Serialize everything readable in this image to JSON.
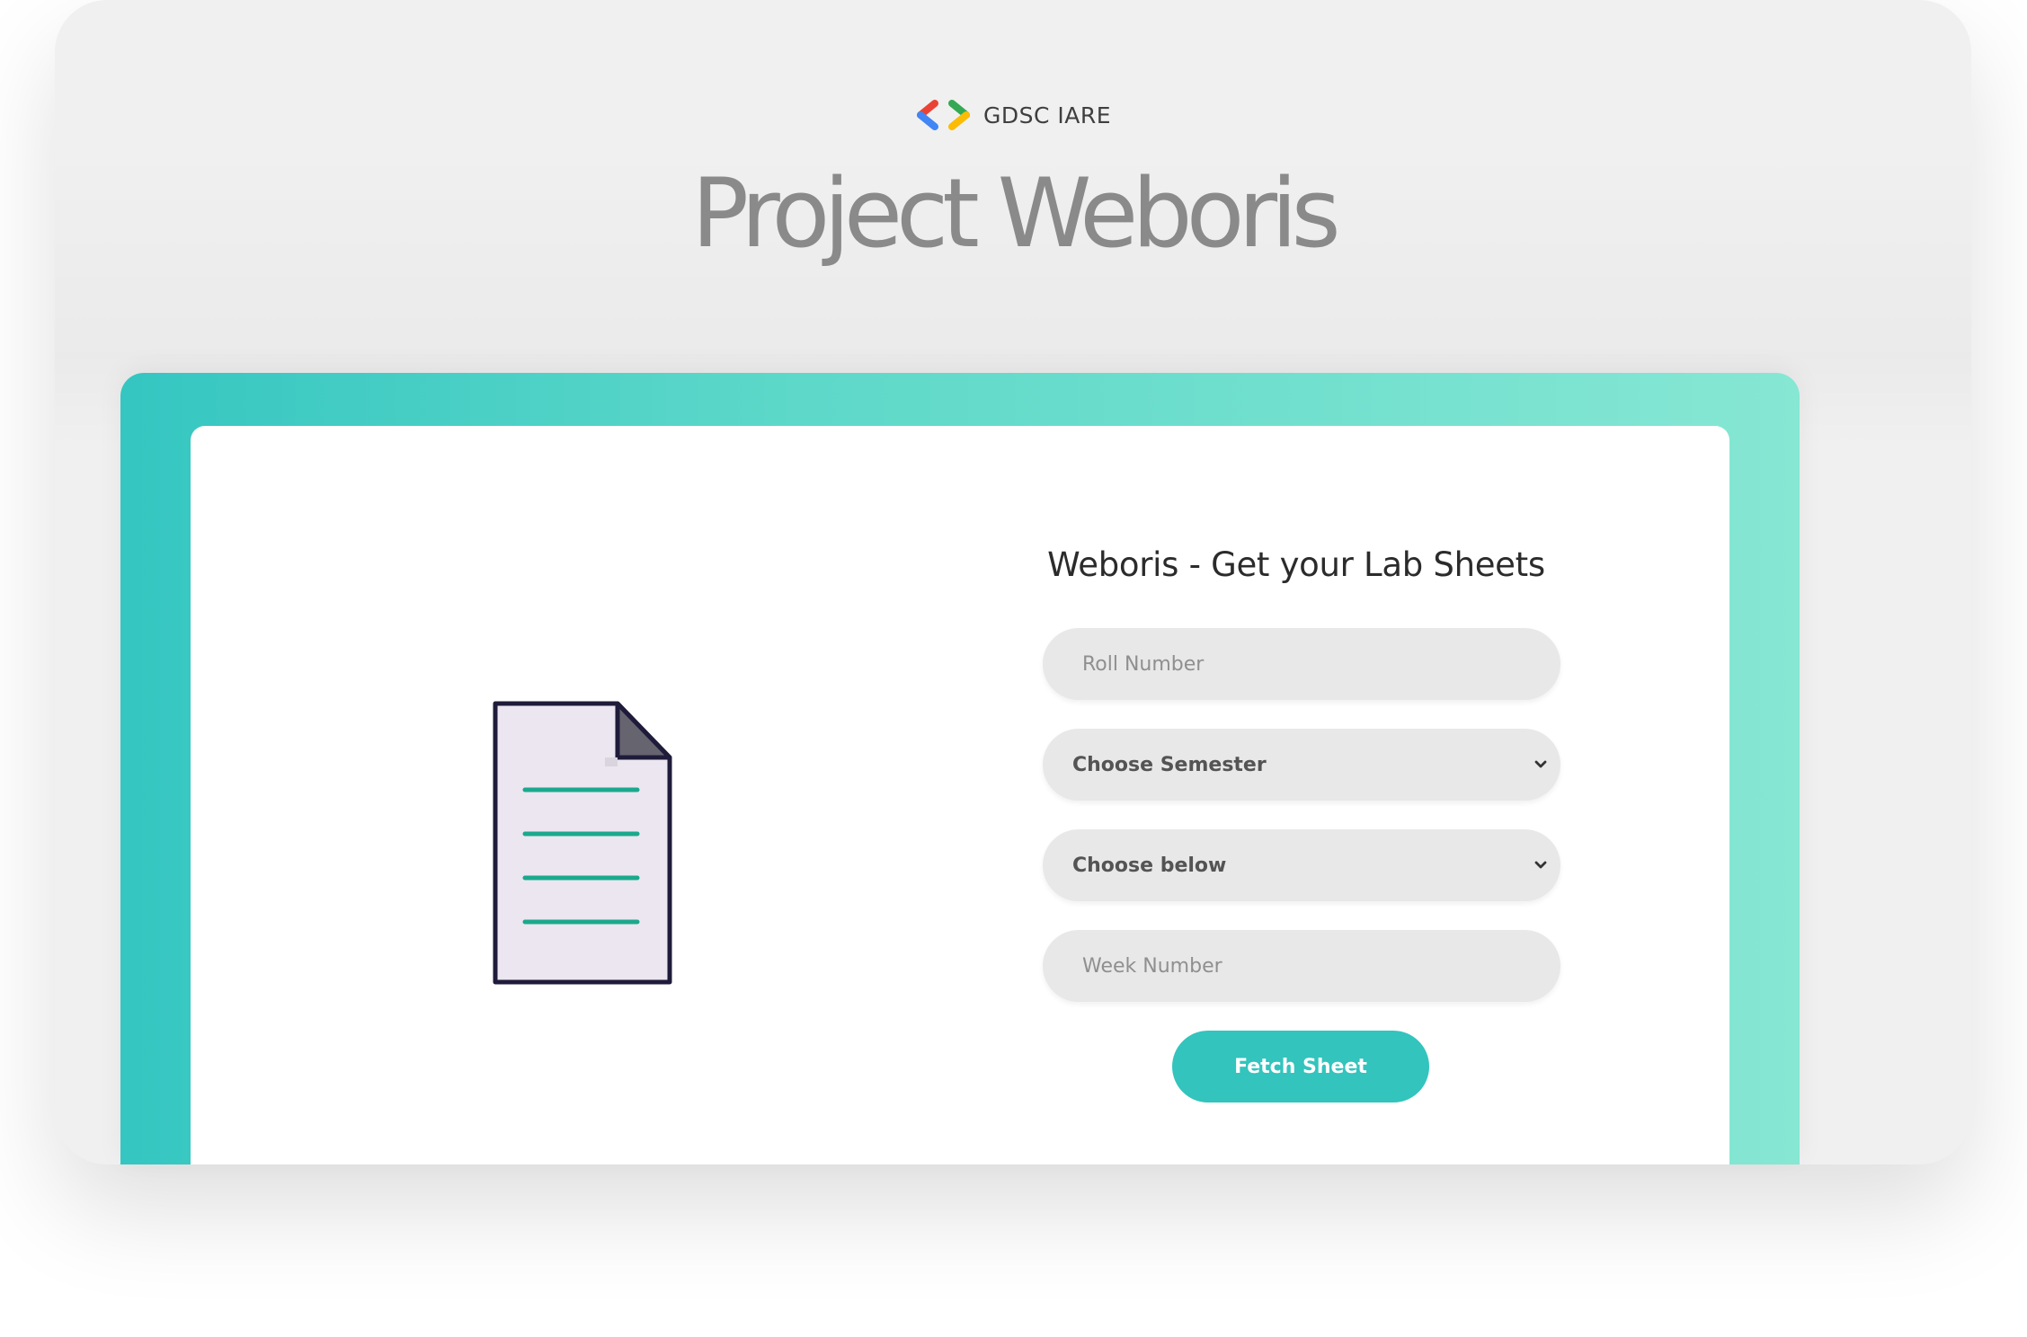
{
  "brand": {
    "name": "GDSC IARE",
    "logo_icon": "gdsc-logo-icon",
    "colors": {
      "blue": "#4285F4",
      "red": "#EA4335",
      "green": "#34A853",
      "yellow": "#FBBC05"
    }
  },
  "header": {
    "title": "Project Weboris"
  },
  "frame": {
    "gradient_start": "#35c6c1",
    "gradient_end": "#86e7d3"
  },
  "illustration": {
    "icon": "document-icon",
    "line_color": "#1ba88d"
  },
  "form": {
    "title": "Weboris - Get your Lab Sheets",
    "roll_number": {
      "placeholder": "Roll Number",
      "value": ""
    },
    "semester": {
      "selected": "Choose Semester",
      "icon": "chevron-down-icon"
    },
    "subject": {
      "selected": "Choose below",
      "icon": "chevron-down-icon"
    },
    "week_number": {
      "placeholder": "Week Number",
      "value": ""
    },
    "submit_label": "Fetch Sheet",
    "accent": "#32c4bd"
  }
}
